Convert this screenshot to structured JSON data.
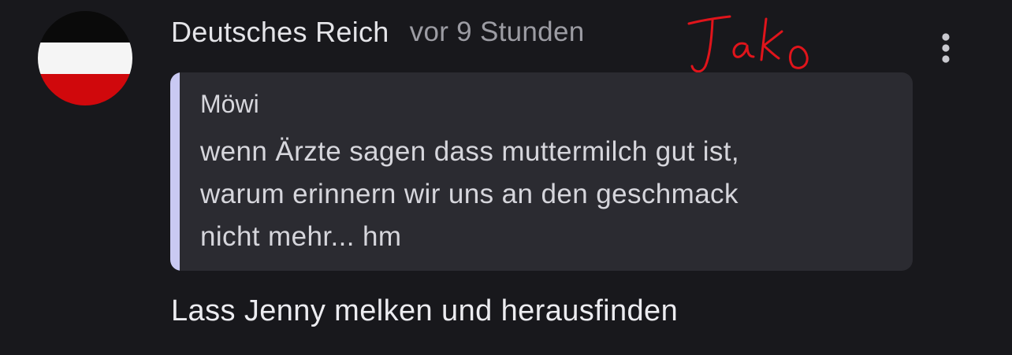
{
  "comment": {
    "author": "Deutsches Reich",
    "timestamp": "vor 9 Stunden",
    "avatar": {
      "stripes": [
        "#0a0a0a",
        "#f5f5f5",
        "#d0080c"
      ]
    },
    "more_icon": "more-vertical-icon",
    "handwritten_annotation": "Jako",
    "quote": {
      "author": "Möwi",
      "lines": [
        "wenn Ärzte sagen dass muttermilch gut ist,",
        "warum erinnern wir uns an den geschmack",
        "nicht mehr... hm"
      ]
    },
    "text": "Lass Jenny melken und herausfinden"
  },
  "colors": {
    "background": "#18181c",
    "quote_background": "#2b2b31",
    "quote_accent": "#c9c9f2",
    "annotation": "#e0141b"
  }
}
